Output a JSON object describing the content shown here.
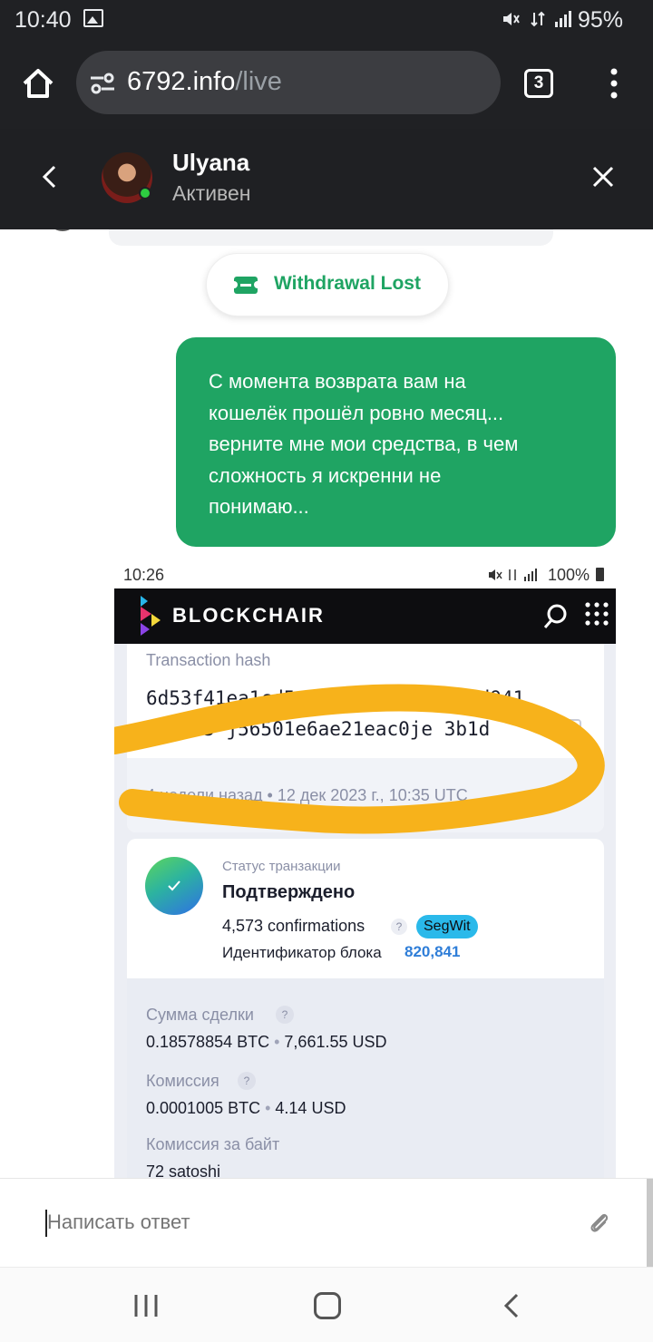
{
  "status_bar": {
    "time": "10:40",
    "battery": "95%"
  },
  "browser": {
    "url_host": "6792.info",
    "url_path": "/live",
    "tab_count": "3"
  },
  "chat_header": {
    "name": "Ulyana",
    "status": "Активен"
  },
  "messages": {
    "withdrawal_chip": "Withdrawal Lost",
    "user_message": [
      "С момента возврата вам на",
      "кошелёк прошёл ровно месяц...",
      "верните мне мои средства, в чем",
      "сложность я искренни не",
      "понимаю..."
    ]
  },
  "attachment": {
    "status_time": "10:26",
    "status_battery": "100%",
    "brand": "BLOCKCHAIR",
    "tx_hash_label": "Transaction hash",
    "tx_hash_line1": "6d53f41ea1cd5e470ee8e808e5b84d941",
    "tx_hash_line2": "2e2cb5 j56501e6ae21eac0je  3b1d",
    "tx_time": "4 недели назад • 12 дек 2023 г., 10:35 UTC",
    "status_label": "Статус транзакции",
    "status_value": "Подтверждено",
    "confirmations": "4,573 confirmations",
    "segwit_badge": "SegWit",
    "block_id_label": "Идентификатор блока",
    "block_id_value": "820,841",
    "amount_label": "Сумма сделки",
    "amount_btc": "0.18578854 BTC",
    "amount_usd": "7,661.55 USD",
    "fee_label": "Комиссия",
    "fee_btc": "0.0001005 BTC",
    "fee_usd": "4.14 USD",
    "fee_per_byte_label": "Комиссия за байт",
    "fee_per_byte_value": "72 satoshi"
  },
  "composer": {
    "placeholder": "Написать ответ"
  },
  "colors": {
    "accent_green": "#1fa463",
    "highlighter": "#f7b21b",
    "link_blue": "#2f7ed8",
    "badge_cyan": "#2ab9ea"
  }
}
